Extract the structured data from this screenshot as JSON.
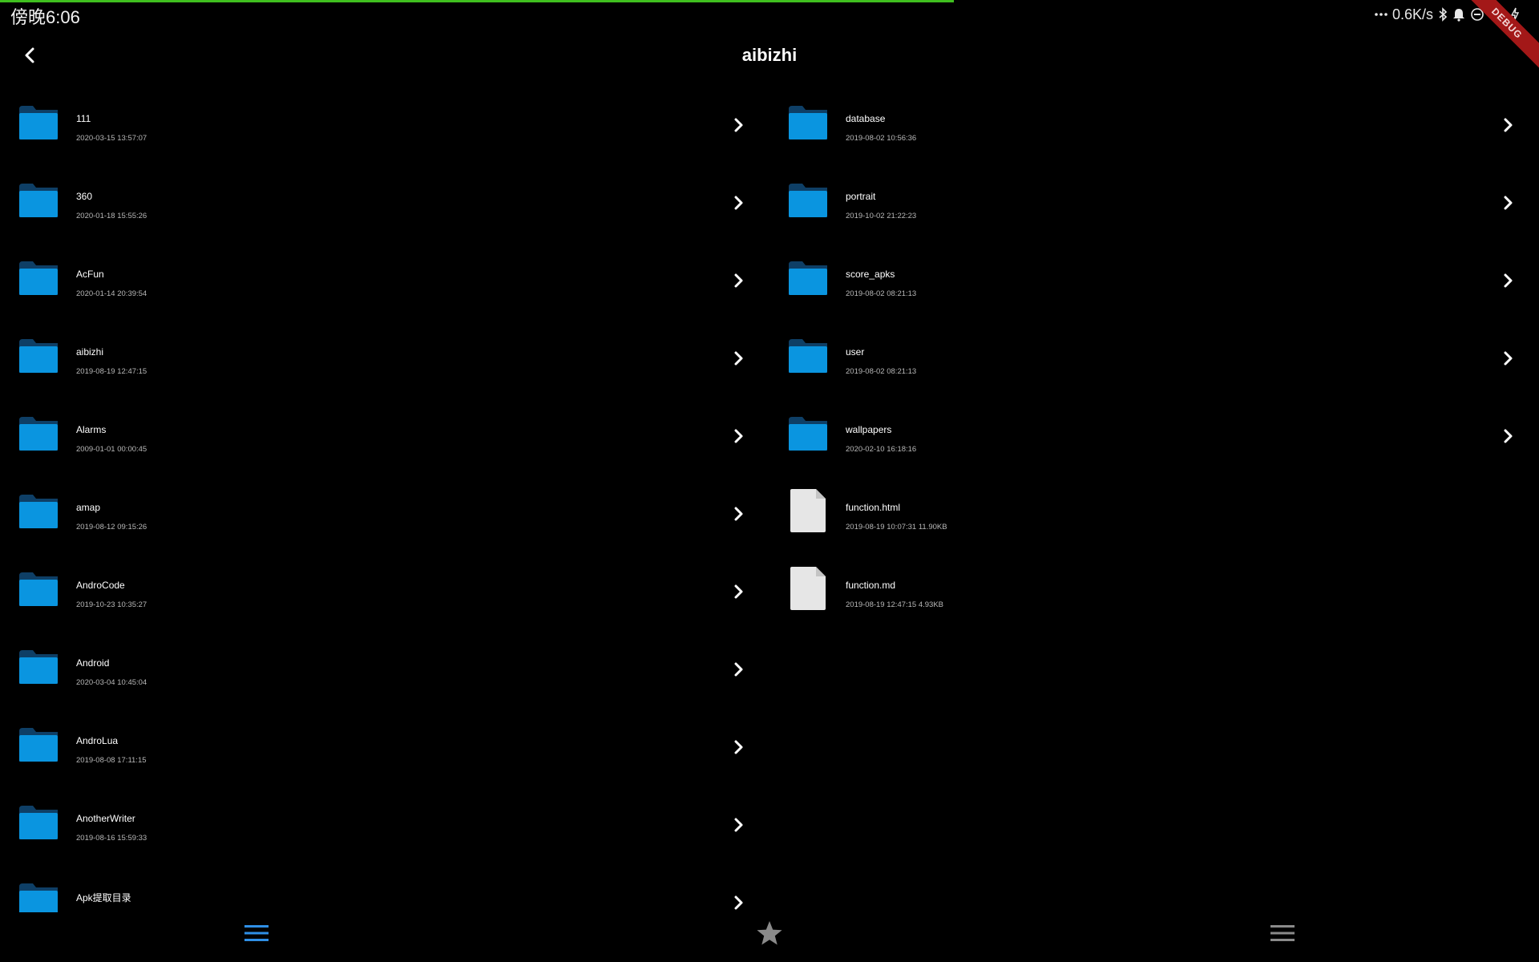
{
  "status_bar": {
    "time": "傍晚6:06",
    "network_speed": "0.6K/s",
    "icons": [
      "more-dots-icon",
      "bluetooth-icon",
      "bell-icon",
      "do-not-disturb-icon",
      "wifi-icon",
      "charging-icon"
    ],
    "debug_label": "DEBUG"
  },
  "header": {
    "title": "aibizhi",
    "back_icon": "chevron-left-icon"
  },
  "left_list": [
    {
      "name": "111",
      "meta": "2020-03-15 13:57:07",
      "type": "folder"
    },
    {
      "name": "360",
      "meta": "2020-01-18 15:55:26",
      "type": "folder"
    },
    {
      "name": "AcFun",
      "meta": "2020-01-14 20:39:54",
      "type": "folder"
    },
    {
      "name": "aibizhi",
      "meta": "2019-08-19 12:47:15",
      "type": "folder"
    },
    {
      "name": "Alarms",
      "meta": "2009-01-01 00:00:45",
      "type": "folder"
    },
    {
      "name": "amap",
      "meta": "2019-08-12 09:15:26",
      "type": "folder"
    },
    {
      "name": "AndroCode",
      "meta": "2019-10-23 10:35:27",
      "type": "folder"
    },
    {
      "name": "Android",
      "meta": "2020-03-04 10:45:04",
      "type": "folder"
    },
    {
      "name": "AndroLua",
      "meta": "2019-08-08 17:11:15",
      "type": "folder"
    },
    {
      "name": "AnotherWriter",
      "meta": "2019-08-16 15:59:33",
      "type": "folder"
    },
    {
      "name": "Apk提取目录",
      "meta": "",
      "type": "folder"
    }
  ],
  "right_list": [
    {
      "name": "database",
      "meta": "2019-08-02 10:56:36",
      "type": "folder"
    },
    {
      "name": "portrait",
      "meta": "2019-10-02 21:22:23",
      "type": "folder"
    },
    {
      "name": "score_apks",
      "meta": "2019-08-02 08:21:13",
      "type": "folder"
    },
    {
      "name": "user",
      "meta": "2019-08-02 08:21:13",
      "type": "folder"
    },
    {
      "name": "wallpapers",
      "meta": "2020-02-10 16:18:16",
      "type": "folder"
    },
    {
      "name": "function.html",
      "meta": "2019-08-19 10:07:31 11.90KB",
      "type": "file"
    },
    {
      "name": "function.md",
      "meta": "2019-08-19 12:47:15 4.93KB",
      "type": "file"
    }
  ],
  "bottom_nav": {
    "items": [
      {
        "icon": "menu-lines-icon",
        "active": true
      },
      {
        "icon": "star-icon",
        "active": false
      },
      {
        "icon": "menu-lines-icon",
        "active": false
      }
    ]
  },
  "colors": {
    "background": "#000000",
    "folder": "#0a95e0",
    "folder_tab": "#0e3f66",
    "accent": "#2f8fe6",
    "progress": "#3fbf1f",
    "inactive_icon": "#8a8a8a"
  }
}
